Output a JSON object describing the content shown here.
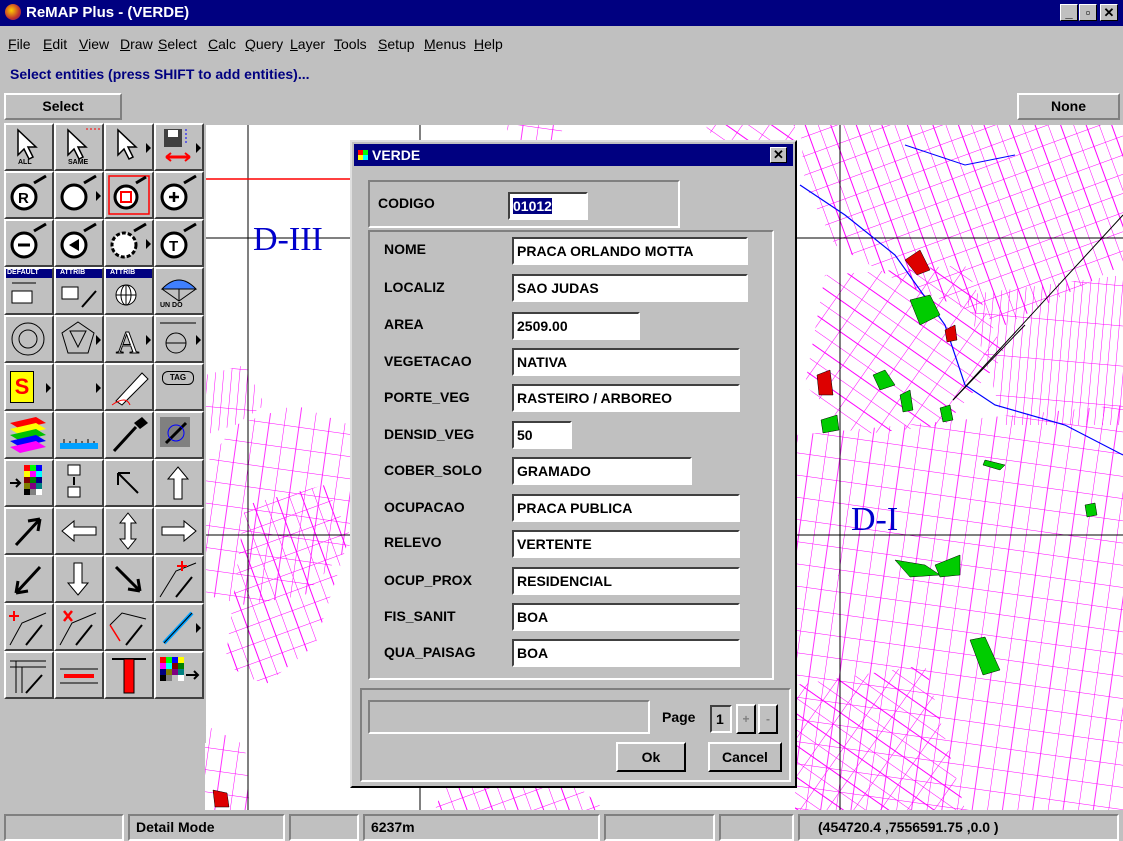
{
  "window": {
    "title": "ReMAP Plus - (VERDE)",
    "minimize": "_",
    "maximize": "▫",
    "close": "✕"
  },
  "menu": [
    "File",
    "Edit",
    "View",
    "Draw",
    "Select",
    "Calc",
    "Query",
    "Layer",
    "Tools",
    "Setup",
    "Menus",
    "Help"
  ],
  "prompt": "Select entities (press SHIFT to add entities)...",
  "mode_left": "Select",
  "mode_right": "None",
  "toolbar": {
    "labels": {
      "all": "ALL",
      "same": "SAME",
      "default": "DEFAULT",
      "attrib1": "ATTRIB",
      "attrib2": "ATTRIB",
      "undo": "UN DO",
      "tag": "TAG",
      "s": "S",
      "a": "A",
      "r": "R",
      "t": "T"
    }
  },
  "map": {
    "labels": [
      "D-III",
      "D-I"
    ],
    "colors": {
      "streets": "#ff00ff",
      "river": "#0000ff",
      "green": "#00cc00",
      "red": "#cc0000"
    }
  },
  "dialog": {
    "title": "VERDE",
    "close": "✕",
    "codigo_label": "CODIGO",
    "codigo_value": "01012",
    "fields": [
      {
        "label": "NOME",
        "value": "PRACA ORLANDO MOTTA"
      },
      {
        "label": "LOCALIZ",
        "value": "SAO JUDAS"
      },
      {
        "label": "AREA",
        "value": "2509.00"
      },
      {
        "label": "VEGETACAO",
        "value": "NATIVA"
      },
      {
        "label": "PORTE_VEG",
        "value": "RASTEIRO / ARBOREO"
      },
      {
        "label": "DENSID_VEG",
        "value": "50"
      },
      {
        "label": "COBER_SOLO",
        "value": "GRAMADO"
      },
      {
        "label": "OCUPACAO",
        "value": "PRACA PUBLICA"
      },
      {
        "label": "RELEVO",
        "value": "VERTENTE"
      },
      {
        "label": "OCUP_PROX",
        "value": "RESIDENCIAL"
      },
      {
        "label": "FIS_SANIT",
        "value": "BOA"
      },
      {
        "label": "QUA_PAISAG",
        "value": "BOA"
      }
    ],
    "page_label": "Page",
    "page_value": "1",
    "page_next": "+",
    "page_prev": "-",
    "ok": "Ok",
    "cancel": "Cancel"
  },
  "statusbar": {
    "mode": "Detail Mode",
    "scale": "6237m",
    "coords": "(454720.4 ,7556591.75 ,0.0 )"
  }
}
